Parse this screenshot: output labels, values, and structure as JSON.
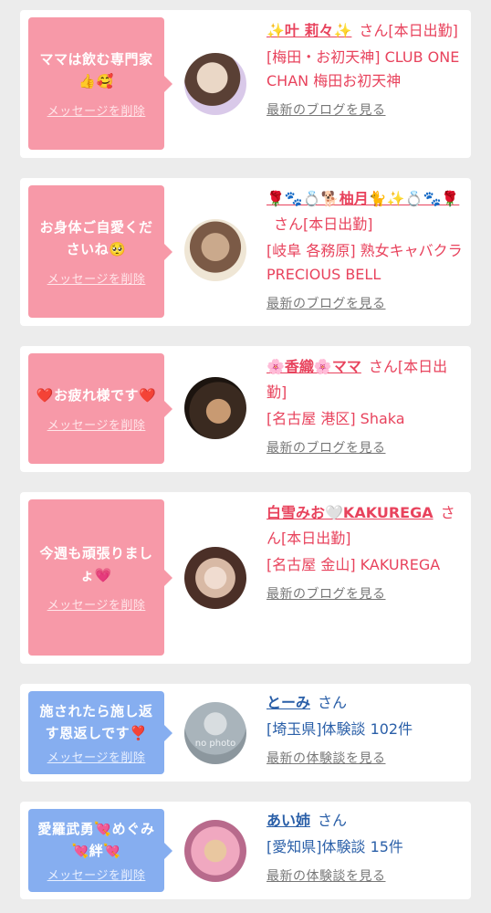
{
  "items": [
    {
      "message": "ママは飲む専門家👍🥰",
      "delete_label": "メッセージを削除",
      "name": "✨叶 莉々✨",
      "suffix": "さん[本日出勤]",
      "detail": "[梅田・お初天神] CLUB ONE CHAN 梅田お初天神",
      "link": "最新のブログを見る",
      "theme": "pink",
      "avatar_colors": [
        "#ead7c6",
        "#5a4035",
        "#d9c9e9"
      ]
    },
    {
      "message": "お身体ご自愛くださいね🥺",
      "delete_label": "メッセージを削除",
      "name": "🌹🐾💍🐕柚月🐈✨💍🐾🌹",
      "suffix": "さん[本日出勤]",
      "detail": "[岐阜 各務原] 熟女キャバクラ PRECIOUS BELL",
      "link": "最新のブログを見る",
      "theme": "pink",
      "avatar_colors": [
        "#caa98c",
        "#7b5a46",
        "#efe6d5"
      ]
    },
    {
      "message": "❤️お疲れ様です❤️",
      "delete_label": "メッセージを削除",
      "name": "🌸香織🌸ママ",
      "suffix": "さん[本日出勤]",
      "detail": "[名古屋 港区] Shaka",
      "link": "最新のブログを見る",
      "theme": "pink",
      "avatar_colors": [
        "#3a2a20",
        "#c89a72",
        "#1c140f"
      ]
    },
    {
      "message": "今週も頑張りましょ💗",
      "delete_label": "メッセージを削除",
      "name": "白雪みお🤍KAKUREGA",
      "suffix": "さん[本日出勤]",
      "detail": "[名古屋 金山] KAKUREGA",
      "link": "最新のブログを見る",
      "theme": "pink",
      "avatar_colors": [
        "#d8b9a5",
        "#4b2f27",
        "#f0dcd0"
      ]
    },
    {
      "message": "施されたら施し返す恩返しです❣️",
      "delete_label": "メッセージを削除",
      "name": "とーみ",
      "suffix": "さん",
      "detail": "[埼玉県]体験談 102件",
      "link": "最新の体験談を見る",
      "theme": "blue",
      "avatar_colors": [
        "#a9b4bb",
        "#d8dde0",
        "#8c979e"
      ],
      "avatar_text": "no photo"
    },
    {
      "message": "愛羅武勇💘めぐみ💘絆💘",
      "delete_label": "メッセージを削除",
      "name": "あい姉",
      "suffix": "さん",
      "detail": "[愛知県]体験談 15件",
      "link": "最新の体験談を見る",
      "theme": "blue",
      "avatar_colors": [
        "#f0a8c0",
        "#e9c7a0",
        "#b86a8c"
      ]
    }
  ]
}
